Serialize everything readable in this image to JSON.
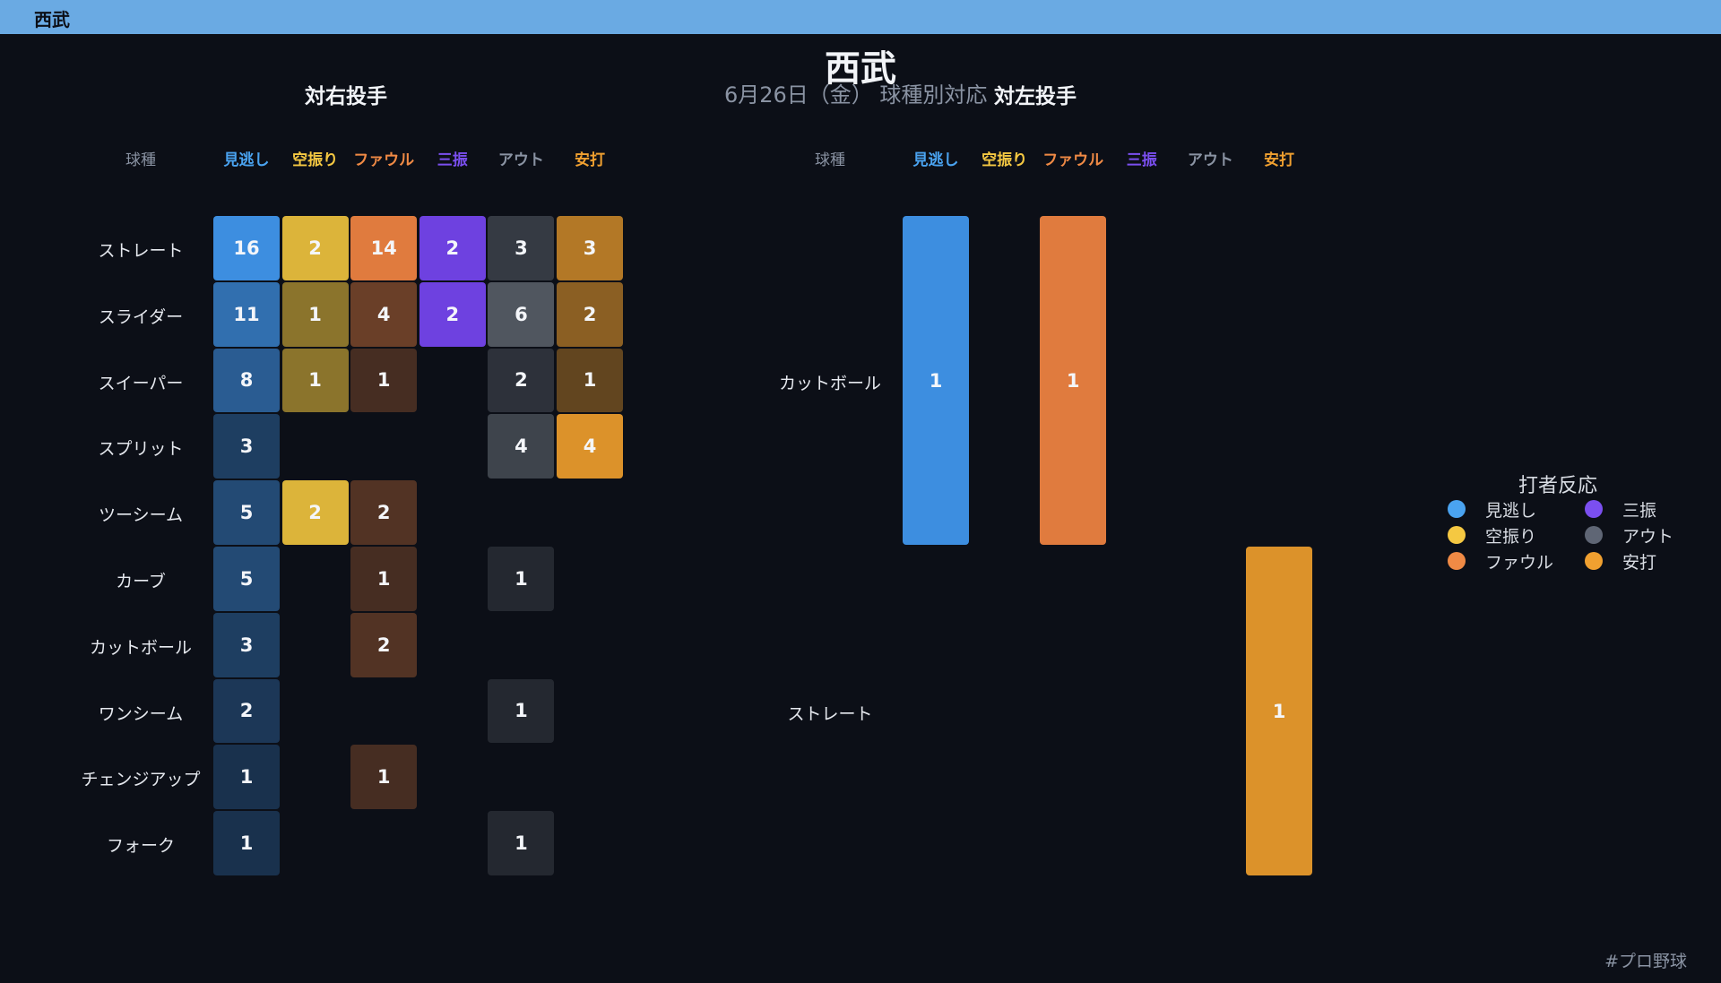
{
  "window": {
    "title": "西武"
  },
  "footer": {
    "hashtag": "#プロ野球"
  },
  "legend": {
    "title": "打者反応",
    "items": [
      {
        "label": "見逃し",
        "color": "#4aa3f0"
      },
      {
        "label": "空振り",
        "color": "#f5c842"
      },
      {
        "label": "ファウル",
        "color": "#f08a45"
      },
      {
        "label": "三振",
        "color": "#7b4ff0"
      },
      {
        "label": "アウト",
        "color": "#5f6675"
      },
      {
        "label": "安打",
        "color": "#f0a030"
      }
    ]
  },
  "chart_data": {
    "type": "heatmap",
    "title": "西武",
    "subtitle": "6月26日（金） 球種別対応",
    "columns": [
      "見逃し",
      "空振り",
      "ファウル",
      "三振",
      "アウト",
      "安打"
    ],
    "column_colors": [
      "#4aa3f0",
      "#f5c842",
      "#f08a45",
      "#7b4ff0",
      "#8a93a3",
      "#f0a030"
    ],
    "cell_colors": [
      "#3d8ee0",
      "#dcb43a",
      "#e07b3e",
      "#6e41e0",
      "#50565f",
      "#dc922a"
    ],
    "pitch_header": "球種",
    "panels": [
      {
        "title": "対右投手",
        "pitches": [
          "ストレート",
          "スライダー",
          "スイーパー",
          "スプリット",
          "ツーシーム",
          "カーブ",
          "カットボール",
          "ワンシーム",
          "チェンジアップ",
          "フォーク"
        ],
        "values": [
          [
            16,
            2,
            14,
            2,
            3,
            3
          ],
          [
            11,
            1,
            4,
            2,
            6,
            2
          ],
          [
            8,
            1,
            1,
            0,
            2,
            1
          ],
          [
            3,
            0,
            0,
            0,
            4,
            4
          ],
          [
            5,
            2,
            2,
            0,
            0,
            0
          ],
          [
            5,
            0,
            1,
            0,
            1,
            0
          ],
          [
            3,
            0,
            2,
            0,
            0,
            0
          ],
          [
            2,
            0,
            0,
            0,
            1,
            0
          ],
          [
            1,
            0,
            1,
            0,
            0,
            0
          ],
          [
            1,
            0,
            0,
            0,
            1,
            0
          ]
        ]
      },
      {
        "title": "対左投手",
        "pitches": [
          "カットボール",
          "ストレート"
        ],
        "values": [
          [
            1,
            0,
            1,
            0,
            0,
            0
          ],
          [
            0,
            0,
            0,
            0,
            0,
            1
          ]
        ]
      }
    ]
  }
}
